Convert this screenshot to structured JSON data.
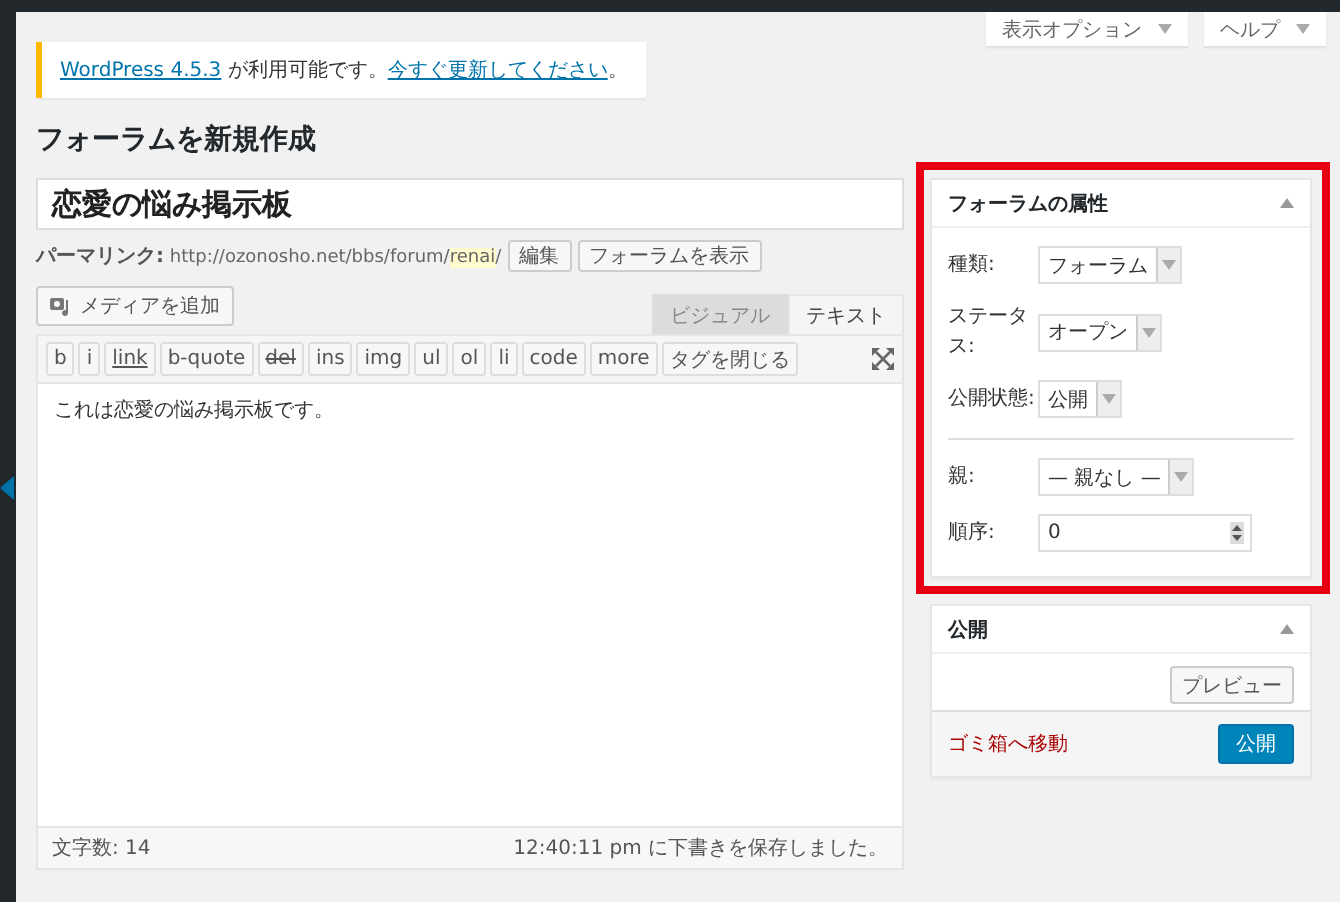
{
  "header_tabs": [
    {
      "label": "表示オプション"
    },
    {
      "label": "ヘルプ"
    }
  ],
  "notice": {
    "version_link": "WordPress 4.5.3",
    "text": "が利用可能です。",
    "update_link": "今すぐ更新してください",
    "end": "。"
  },
  "page_title": "フォーラムを新規作成",
  "title_field": {
    "value": "恋愛の悩み掲示板"
  },
  "permalink": {
    "label": "パーマリンク:",
    "url": "http://ozonosho.net/bbs/forum/",
    "slug": "renai",
    "trailing": "/",
    "buttons": [
      "編集",
      "フォーラムを表示"
    ]
  },
  "media_button": "メディアを追加",
  "editor_tabs": [
    {
      "label": "ビジュアル",
      "selected": false
    },
    {
      "label": "テキスト",
      "selected": true
    }
  ],
  "quicktags": [
    {
      "label": "b",
      "kind": "plain"
    },
    {
      "label": "i",
      "kind": "plain"
    },
    {
      "label": "link",
      "kind": "link"
    },
    {
      "label": "b-quote",
      "kind": "plain"
    },
    {
      "label": "del",
      "kind": "del"
    },
    {
      "label": "ins",
      "kind": "plain"
    },
    {
      "label": "img",
      "kind": "plain"
    },
    {
      "label": "ul",
      "kind": "plain"
    },
    {
      "label": "ol",
      "kind": "plain"
    },
    {
      "label": "li",
      "kind": "plain"
    },
    {
      "label": "code",
      "kind": "plain"
    },
    {
      "label": "more",
      "kind": "plain"
    },
    {
      "label": "タグを閉じる",
      "kind": "plain"
    }
  ],
  "content": "これは恋愛の悩み掲示板です。",
  "status_bar": {
    "word_count": "文字数: 14",
    "autosave": "12:40:11 pm に下書きを保存しました。"
  },
  "attributes_box": {
    "title": "フォーラムの属性",
    "highlighted": true,
    "sections": [
      [
        {
          "kind": "select",
          "label": "種類:",
          "value": "フォーラム"
        },
        {
          "kind": "select",
          "label": "ステータス:",
          "value": "オープン"
        },
        {
          "kind": "select",
          "label": "公開状態:",
          "value": "公開"
        }
      ],
      [
        {
          "kind": "select",
          "label": "親:",
          "value": "— 親なし —"
        },
        {
          "kind": "number",
          "label": "順序:",
          "value": "0"
        }
      ]
    ]
  },
  "publish_box": {
    "title": "公開",
    "preview": "プレビュー",
    "trash": "ゴミ箱へ移動",
    "publish": "公開"
  }
}
